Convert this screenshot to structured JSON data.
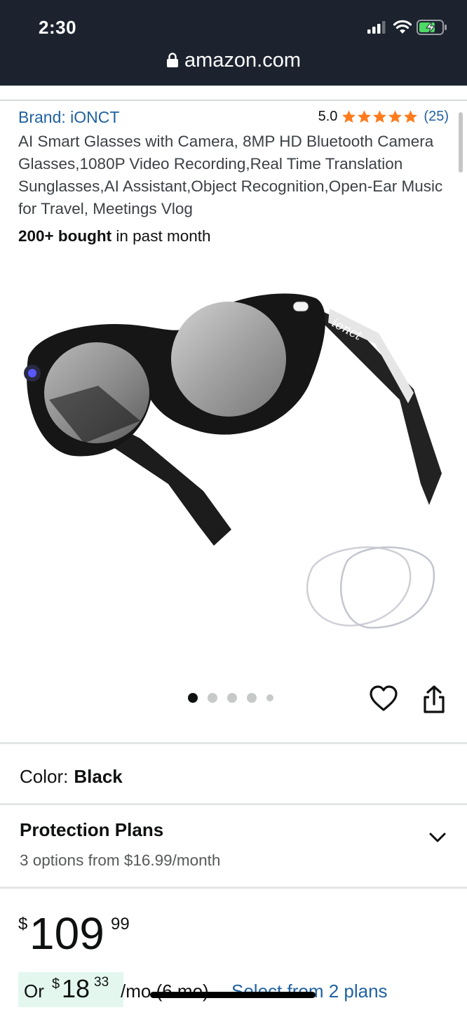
{
  "status_bar": {
    "time": "2:30",
    "url": "amazon.com",
    "icons": [
      "signal-icon",
      "wifi-icon",
      "battery-charging-icon",
      "lock-icon"
    ]
  },
  "product": {
    "brand": "Brand: iONCT",
    "rating_value": "5.0",
    "rating_stars": 5,
    "review_count": "(25)",
    "title": "AI Smart Glasses with Camera, 8MP HD Bluetooth Camera Glasses,1080P Video Recording,Real Time Translation Sunglasses,AI Assistant,Object Recognition,Open-Ear Music for Travel, Meetings Vlog",
    "bought_bold": "200+ bought",
    "bought_rest": " in past month",
    "image_logo": "ionct"
  },
  "gallery": {
    "total_dots": 5,
    "active_index": 0
  },
  "color": {
    "label": "Color:",
    "value": "Black"
  },
  "protection": {
    "title": "Protection Plans",
    "subtitle": "3 options from $16.99/month"
  },
  "price": {
    "symbol": "$",
    "whole": "109",
    "fraction": "99"
  },
  "monthly": {
    "or": "Or",
    "symbol": "$",
    "whole": "18",
    "fraction": "33",
    "per": "/mo (6 mo)",
    "select_link": "Select from 2 plans"
  },
  "colors": {
    "header_bg": "#1c232f",
    "link": "#2162a1",
    "star": "#ff7b1c",
    "monthly_badge": "#e3f7ef"
  }
}
